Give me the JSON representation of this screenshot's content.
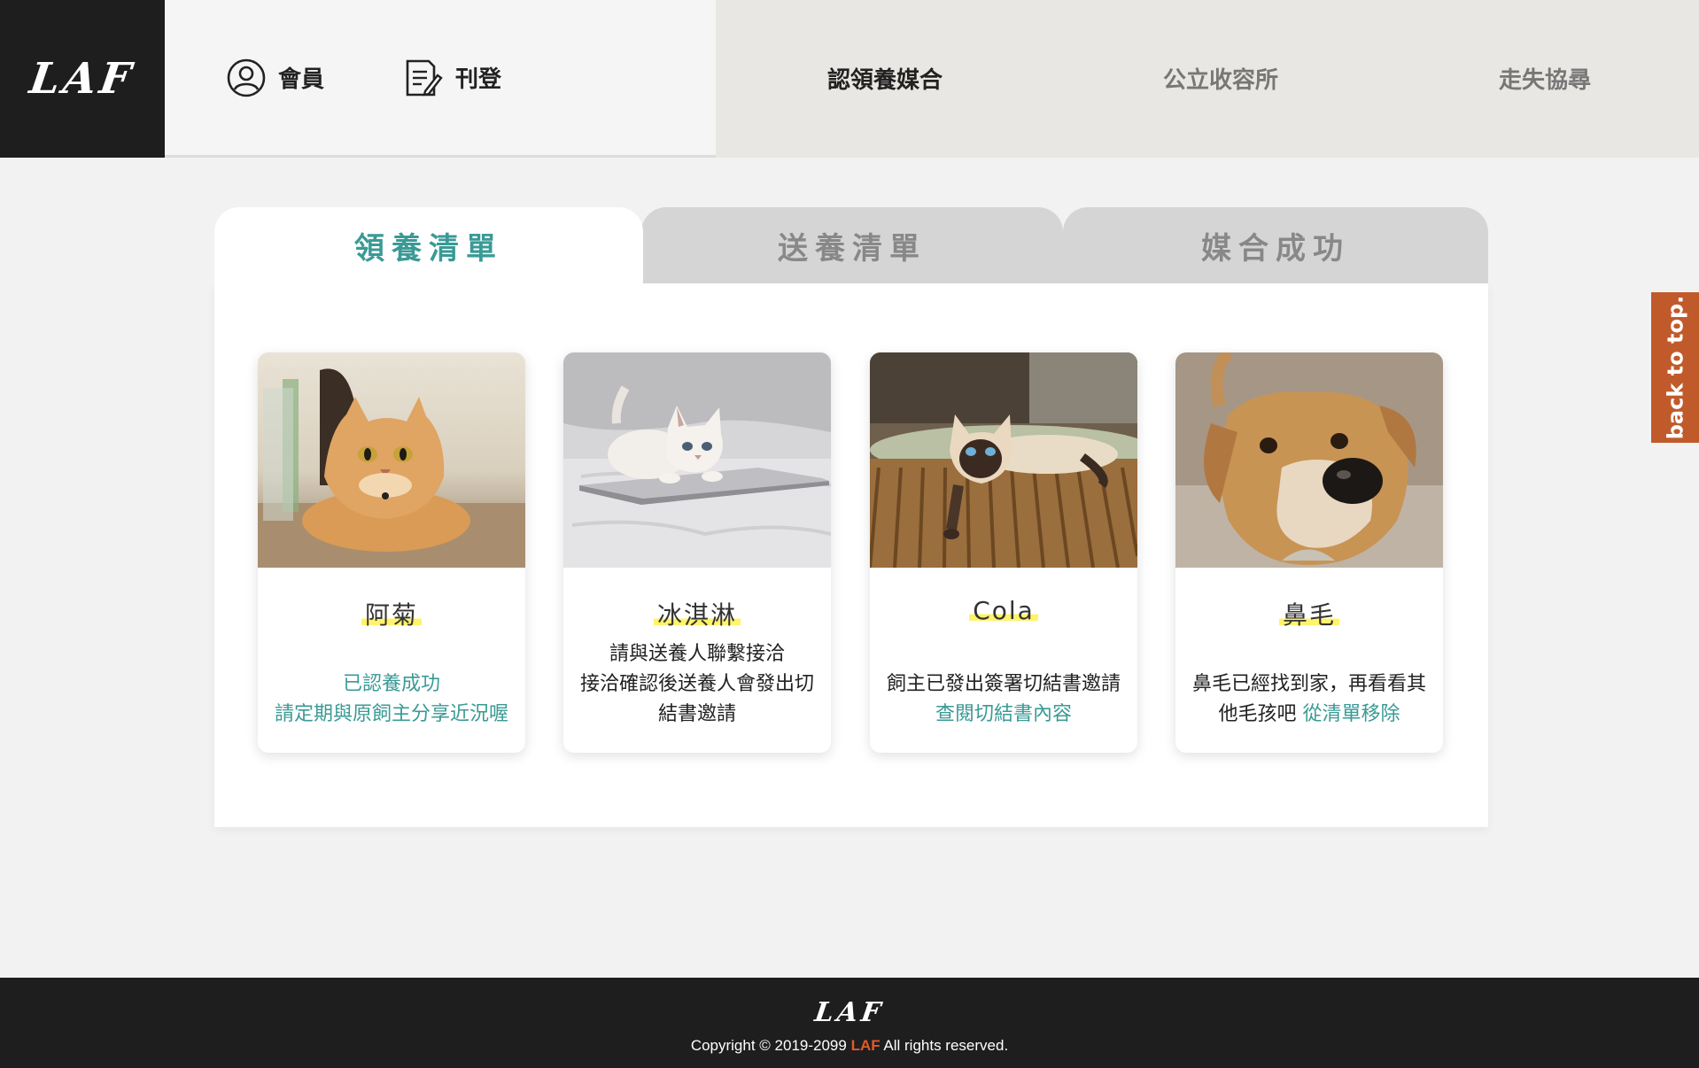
{
  "header": {
    "logo": "LAF",
    "member_label": "會員",
    "post_label": "刊登",
    "nav": [
      "認領養媒合",
      "公立收容所",
      "走失協尋"
    ]
  },
  "tabs": [
    "領養清單",
    "送養清單",
    "媒合成功"
  ],
  "cards": [
    {
      "name": "阿菊",
      "lines": [
        "已認養成功",
        "請定期與原飼主分享近況喔"
      ]
    },
    {
      "name": "冰淇淋",
      "lines": [
        "請與送養人聯繫接洽",
        "接洽確認後送養人會發出切",
        "結書邀請"
      ]
    },
    {
      "name": "Cola",
      "lines": [
        "飼主已發出簽署切結書邀請"
      ],
      "link": "查閱切結書內容"
    },
    {
      "name": "鼻毛",
      "lines": [
        "鼻毛已經找到家，再看看其",
        "他毛孩吧"
      ],
      "link": "從清單移除"
    }
  ],
  "back_to_top": "back to top.",
  "footer": {
    "logo": "LAF",
    "copyright_prefix": "Copyright © 2019-2099 ",
    "copyright_brand": "LAF",
    "copyright_suffix": " All rights reserved."
  },
  "colors": {
    "accent": "#3a9a95",
    "brand_orange": "#c15a2b",
    "dark": "#1e1e1e"
  }
}
